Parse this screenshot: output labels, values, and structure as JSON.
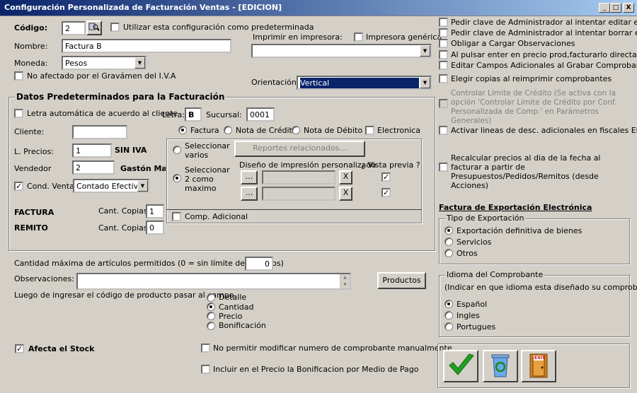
{
  "window": {
    "title": "Configuración Personalizada de Facturación Ventas - [EDICION]",
    "min": "_",
    "max": "□",
    "close": "X"
  },
  "codigo": {
    "label": "Código:",
    "value": "2"
  },
  "utilizar_label": "Utilizar esta configuración como predeterminada",
  "nombre": {
    "label": "Nombre:",
    "value": "Factura B"
  },
  "moneda": {
    "label": "Moneda:",
    "value": "Pesos"
  },
  "no_afectado": "No afectado por el Gravámen del I.V.A",
  "imprimir": {
    "label": "Imprimir en impresora:",
    "value": ""
  },
  "impresora_generica": "Impresora genérica",
  "orientacion": {
    "label": "Orientación:",
    "value": "Vertical"
  },
  "datos": {
    "title": "Datos Predeterminados para la Facturación",
    "letra_auto": "Letra automática de acuerdo al cliente",
    "letra": {
      "label": "Letra:",
      "value": "B"
    },
    "sucursal": {
      "label": "Sucursal:",
      "value": "0001"
    },
    "cliente": {
      "label": "Cliente:",
      "value": ""
    },
    "lprecios": {
      "label": "L. Precios:",
      "value": "1",
      "name": "SIN IVA"
    },
    "vendedor": {
      "label": "Vendedor",
      "value": "2",
      "name": "Gastón Mar"
    },
    "cond_venta": {
      "label": "Cond. Venta",
      "value": "Contado Efectivo"
    },
    "tipos": [
      "Factura",
      "Nota de Crédito",
      "Nota de Débito"
    ],
    "electronica": "Electronica",
    "sel_varios": "Seleccionar varios",
    "sel_dos": "Seleccionar 2 como maximo",
    "reportes": "Reportes relacionados...",
    "diseno": "Diseño de impresión personalizado",
    "vista": "¿ Vista previa ?",
    "dots": "...",
    "x": "X",
    "comp_adicional": "Comp. Adicional",
    "factura": {
      "label": "FACTURA",
      "copias_label": "Cant. Copias",
      "copias": "1"
    },
    "remito": {
      "label": "REMITO",
      "copias_label": "Cant. Copias",
      "copias": "0"
    }
  },
  "cant_max": {
    "label": "Cantidad máxima de artículos permitidos (0 = sin límite de artículos)",
    "value": "0"
  },
  "observaciones": {
    "label": "Observaciones:",
    "value": ""
  },
  "productos": "Productos",
  "luego": {
    "label": "Luego de ingresar el código de producto pasar al campo",
    "options": [
      "Detalle",
      "Cantidad",
      "Precio",
      "Bonificación"
    ]
  },
  "afecta_stock": "Afecta el Stock",
  "no_permitir": "No permitir modificar numero de comprobante manualmente",
  "incluir": "Incluir en el Precio la Bonificacion por Medio de Pago",
  "right": {
    "opts": [
      "Pedir clave de Administrador al intentar editar el comp.",
      "Pedir clave de Administrador al intentar borrar el comp.",
      "Obligar a Cargar Observaciones",
      "Al pulsar enter en precio prod,facturarlo directamente",
      "Editar Campos Adicionales al Grabar Comprobante",
      "Elegir copias al reimprimir comprobantes"
    ],
    "controlar": "Controlar Límite de Crédito (Se activa con la opción 'Controlar Límite de Crédito por Conf. Personalizada de Comp.' en Parámetros Generales)",
    "activar": "Activar lineas de desc. adicionales en fiscales EPSON",
    "recalcular": "Recalcular precios al dia de la fecha al facturar a partir de Presupuestos/Pedidos/Remitos (desde Acciones)",
    "export_title": "Factura de Exportación Electrónica",
    "tipo_title": "Tipo de Exportación",
    "tipo_opts": [
      "Exportación definitiva de bienes",
      "Servicios",
      "Otros"
    ],
    "idioma_title": "Idioma del Comprobante",
    "idioma_sub": "(Indicar en que idioma esta diseñado su comprobante)",
    "idioma_opts": [
      "Español",
      "Ingles",
      "Portugues"
    ]
  },
  "toolbar": {
    "ok": "accept-icon",
    "refresh": "recycle-icon",
    "exit": "EXIT"
  }
}
